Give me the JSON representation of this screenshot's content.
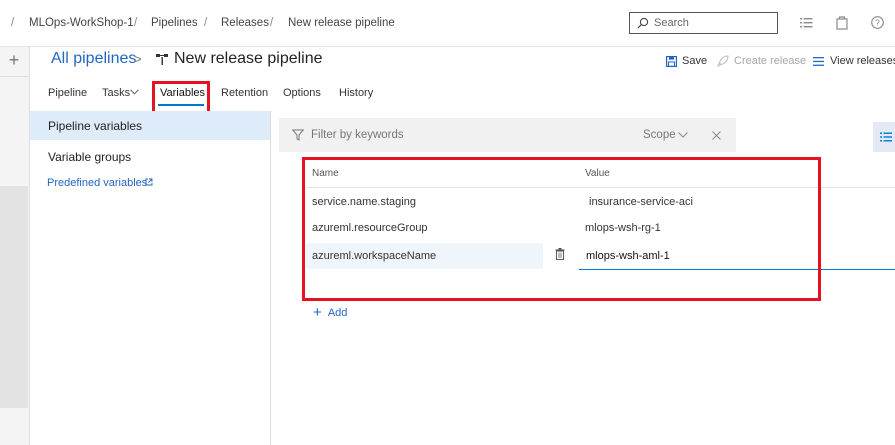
{
  "breadcrumb": {
    "items": [
      "MLOps-WorkShop-1",
      "Pipelines",
      "Releases",
      "New release pipeline"
    ],
    "separator": "/"
  },
  "search": {
    "placeholder": "Search"
  },
  "header": {
    "all_pipelines": "All pipelines",
    "chevron": ">",
    "title": "New release pipeline",
    "actions": {
      "save": "Save",
      "create_release": "Create release",
      "view_releases": "View releases"
    }
  },
  "tabs": [
    {
      "label": "Pipeline"
    },
    {
      "label": "Tasks"
    },
    {
      "label": "Variables",
      "active": true
    },
    {
      "label": "Retention"
    },
    {
      "label": "Options"
    },
    {
      "label": "History"
    }
  ],
  "left_nav": {
    "pipeline_variables": "Pipeline variables",
    "variable_groups": "Variable groups",
    "predefined_variables": "Predefined variables"
  },
  "filter": {
    "placeholder": "Filter by keywords",
    "scope": "Scope"
  },
  "grid": {
    "headers": {
      "name": "Name",
      "value": "Value"
    },
    "rows": [
      {
        "name": "service.name.staging",
        "value": "insurance-service-aci"
      },
      {
        "name": "azureml.resourceGroup",
        "value": "mlops-wsh-rg-1"
      },
      {
        "name": "azureml.workspaceName",
        "value": "mlops-wsh-aml-1"
      }
    ],
    "add_label": "Add"
  },
  "colors": {
    "accent": "#0078d4",
    "link": "#2266c4",
    "highlight": "#e81123",
    "selected_bg": "#deecf9"
  },
  "icons": [
    "plus-icon",
    "search-icon",
    "list-icon",
    "bag-icon",
    "help-icon",
    "pipeline-icon",
    "save-icon",
    "rocket-icon",
    "chevron-down-icon",
    "external-link-icon",
    "filter-icon",
    "close-icon",
    "trash-icon"
  ]
}
